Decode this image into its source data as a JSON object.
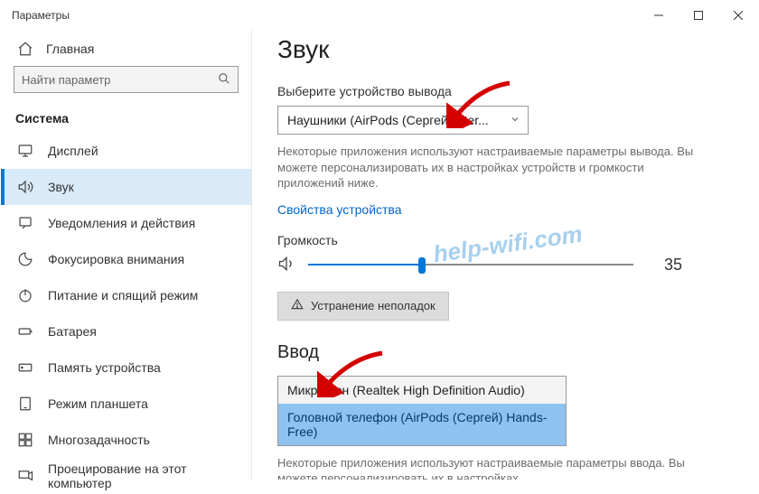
{
  "window": {
    "title": "Параметры"
  },
  "sidebar": {
    "home": "Главная",
    "search_placeholder": "Найти параметр",
    "section": "Система",
    "items": [
      {
        "icon": "display",
        "label": "Дисплей"
      },
      {
        "icon": "sound",
        "label": "Звук",
        "active": true
      },
      {
        "icon": "notify",
        "label": "Уведомления и действия"
      },
      {
        "icon": "focus",
        "label": "Фокусировка внимания"
      },
      {
        "icon": "power",
        "label": "Питание и спящий режим"
      },
      {
        "icon": "battery",
        "label": "Батарея"
      },
      {
        "icon": "storage",
        "label": "Память устройства"
      },
      {
        "icon": "tablet",
        "label": "Режим планшета"
      },
      {
        "icon": "multitask",
        "label": "Многозадачность"
      },
      {
        "icon": "project",
        "label": "Проецирование на этот компьютер"
      }
    ]
  },
  "content": {
    "h1": "Звук",
    "output_label": "Выберите устройство вывода",
    "output_selected": "Наушники (AirPods (Сергей) Ster...",
    "output_help": "Некоторые приложения используют настраиваемые параметры вывода. Вы можете персонализировать их в настройках устройств и громкости приложений ниже.",
    "device_props": "Свойства устройства",
    "volume_label": "Громкость",
    "volume_value": "35",
    "volume_percent": 35,
    "troubleshoot": "Устранение неполадок",
    "input_h2": "Ввод",
    "input_options": [
      "Микрофон (Realtek High Definition Audio)",
      "Головной телефон (AirPods (Сергей) Hands-Free)"
    ],
    "input_selected_index": 1,
    "input_help": "Некоторые приложения используют настраиваемые параметры ввода. Вы можете персонализировать их в настройках"
  },
  "watermark": "help-wifi.com",
  "colors": {
    "accent": "#0078d7",
    "link": "#0066cc",
    "selection": "#8fc3ef"
  }
}
